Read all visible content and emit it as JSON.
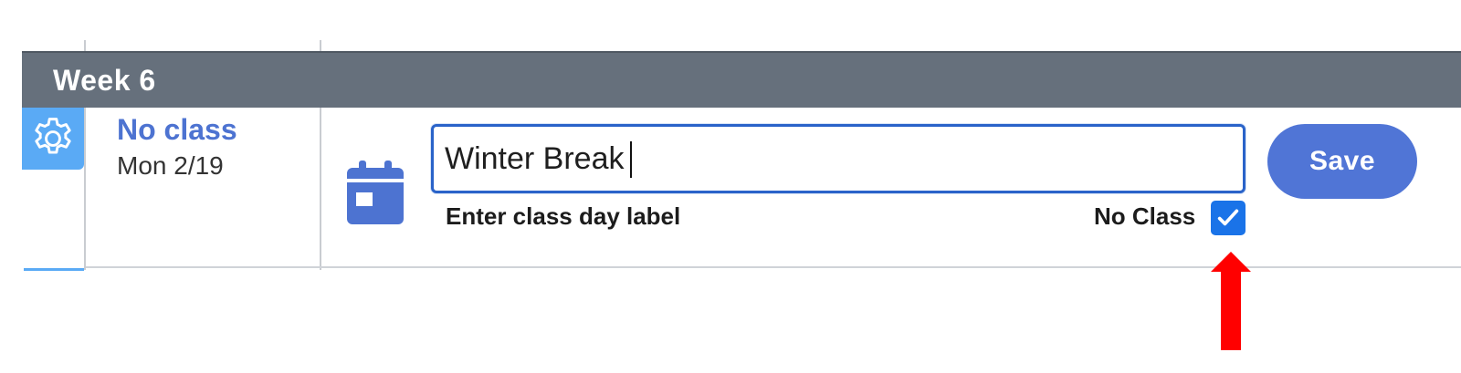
{
  "week": {
    "title": "Week 6"
  },
  "day": {
    "status": "No class",
    "date": "Mon 2/19"
  },
  "editor": {
    "label_value": "Winter Break",
    "hint": "Enter class day label",
    "no_class_label": "No Class",
    "no_class_checked": true,
    "save_label": "Save"
  },
  "icons": {
    "settings": "gear-icon",
    "calendar": "calendar-icon",
    "checkmark": "check-icon",
    "annotation": "red-arrow-up-icon"
  },
  "colors": {
    "header_bg": "#66707c",
    "accent_blue": "#4d73d1",
    "gear_tile": "#5aaaf5",
    "checkbox": "#1a73e8",
    "save_button": "#5075d6",
    "arrow": "#ff0000"
  }
}
